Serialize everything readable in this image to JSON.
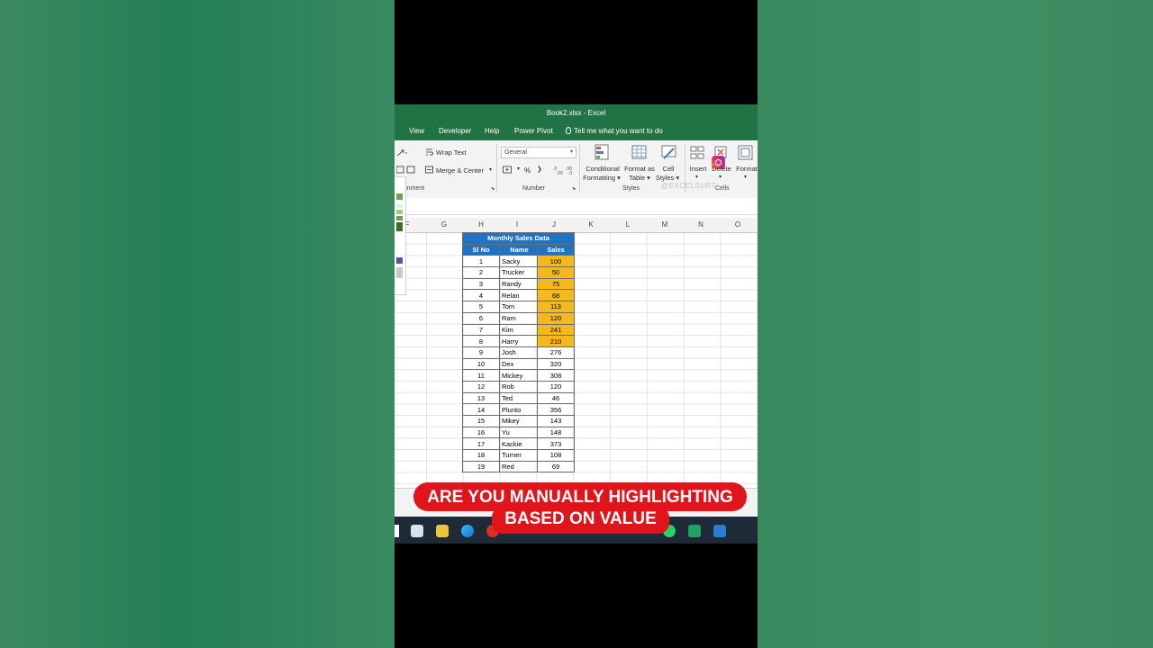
{
  "window": {
    "title": "Book2.xlsx  -  Excel"
  },
  "menu": [
    {
      "label": "View"
    },
    {
      "label": "Developer"
    },
    {
      "label": "Help"
    },
    {
      "label": "Power Pivot"
    },
    {
      "label": "Tell me what you want to do"
    }
  ],
  "ribbon": {
    "wrap_text": "Wrap Text",
    "merge_center": "Merge & Center",
    "number_format": "General",
    "percent": "%",
    "conditional_1": "Conditional",
    "conditional_2": "Formatting",
    "format_table_1": "Format as",
    "format_table_2": "Table",
    "cell_styles_1": "Cell",
    "cell_styles_2": "Styles",
    "insert": "Insert",
    "delete": "Delete",
    "format": "Format",
    "group_alignment": "Alignment",
    "group_number": "Number",
    "group_styles": "Styles",
    "group_cells": "Cells",
    "watermark": "@EXCELSURT"
  },
  "columns": [
    "F",
    "G",
    "H",
    "I",
    "J",
    "K",
    "L",
    "M",
    "N",
    "O"
  ],
  "table": {
    "title": "Monthly Sales Data",
    "headers": [
      "Sl No",
      "Name",
      "Sales"
    ],
    "rows": [
      [
        "1",
        "Sacky",
        "100"
      ],
      [
        "2",
        "Trucker",
        "50"
      ],
      [
        "3",
        "Randy",
        "75"
      ],
      [
        "4",
        "Relan",
        "68"
      ],
      [
        "5",
        "Tom",
        "113"
      ],
      [
        "6",
        "Ram",
        "120"
      ],
      [
        "7",
        "Kim",
        "241"
      ],
      [
        "8",
        "Harry",
        "210"
      ],
      [
        "9",
        "Josh",
        "276"
      ],
      [
        "10",
        "Dex",
        "320"
      ],
      [
        "11",
        "Mickey",
        "308"
      ],
      [
        "12",
        "Rob",
        "120"
      ],
      [
        "13",
        "Ted",
        "46"
      ],
      [
        "14",
        "Plunto",
        "356"
      ],
      [
        "15",
        "Mikey",
        "143"
      ],
      [
        "16",
        "Yu",
        "148"
      ],
      [
        "17",
        "Kackie",
        "373"
      ],
      [
        "18",
        "Turner",
        "108"
      ],
      [
        "19",
        "Red",
        "69"
      ]
    ],
    "highlight_color": "#f6b91b",
    "header_color": "#1f72c4"
  },
  "caption": {
    "line1": "ARE YOU MANUALLY HIGHLIGHTING",
    "line2": "BASED ON VALUE",
    "color": "#e0141b"
  }
}
